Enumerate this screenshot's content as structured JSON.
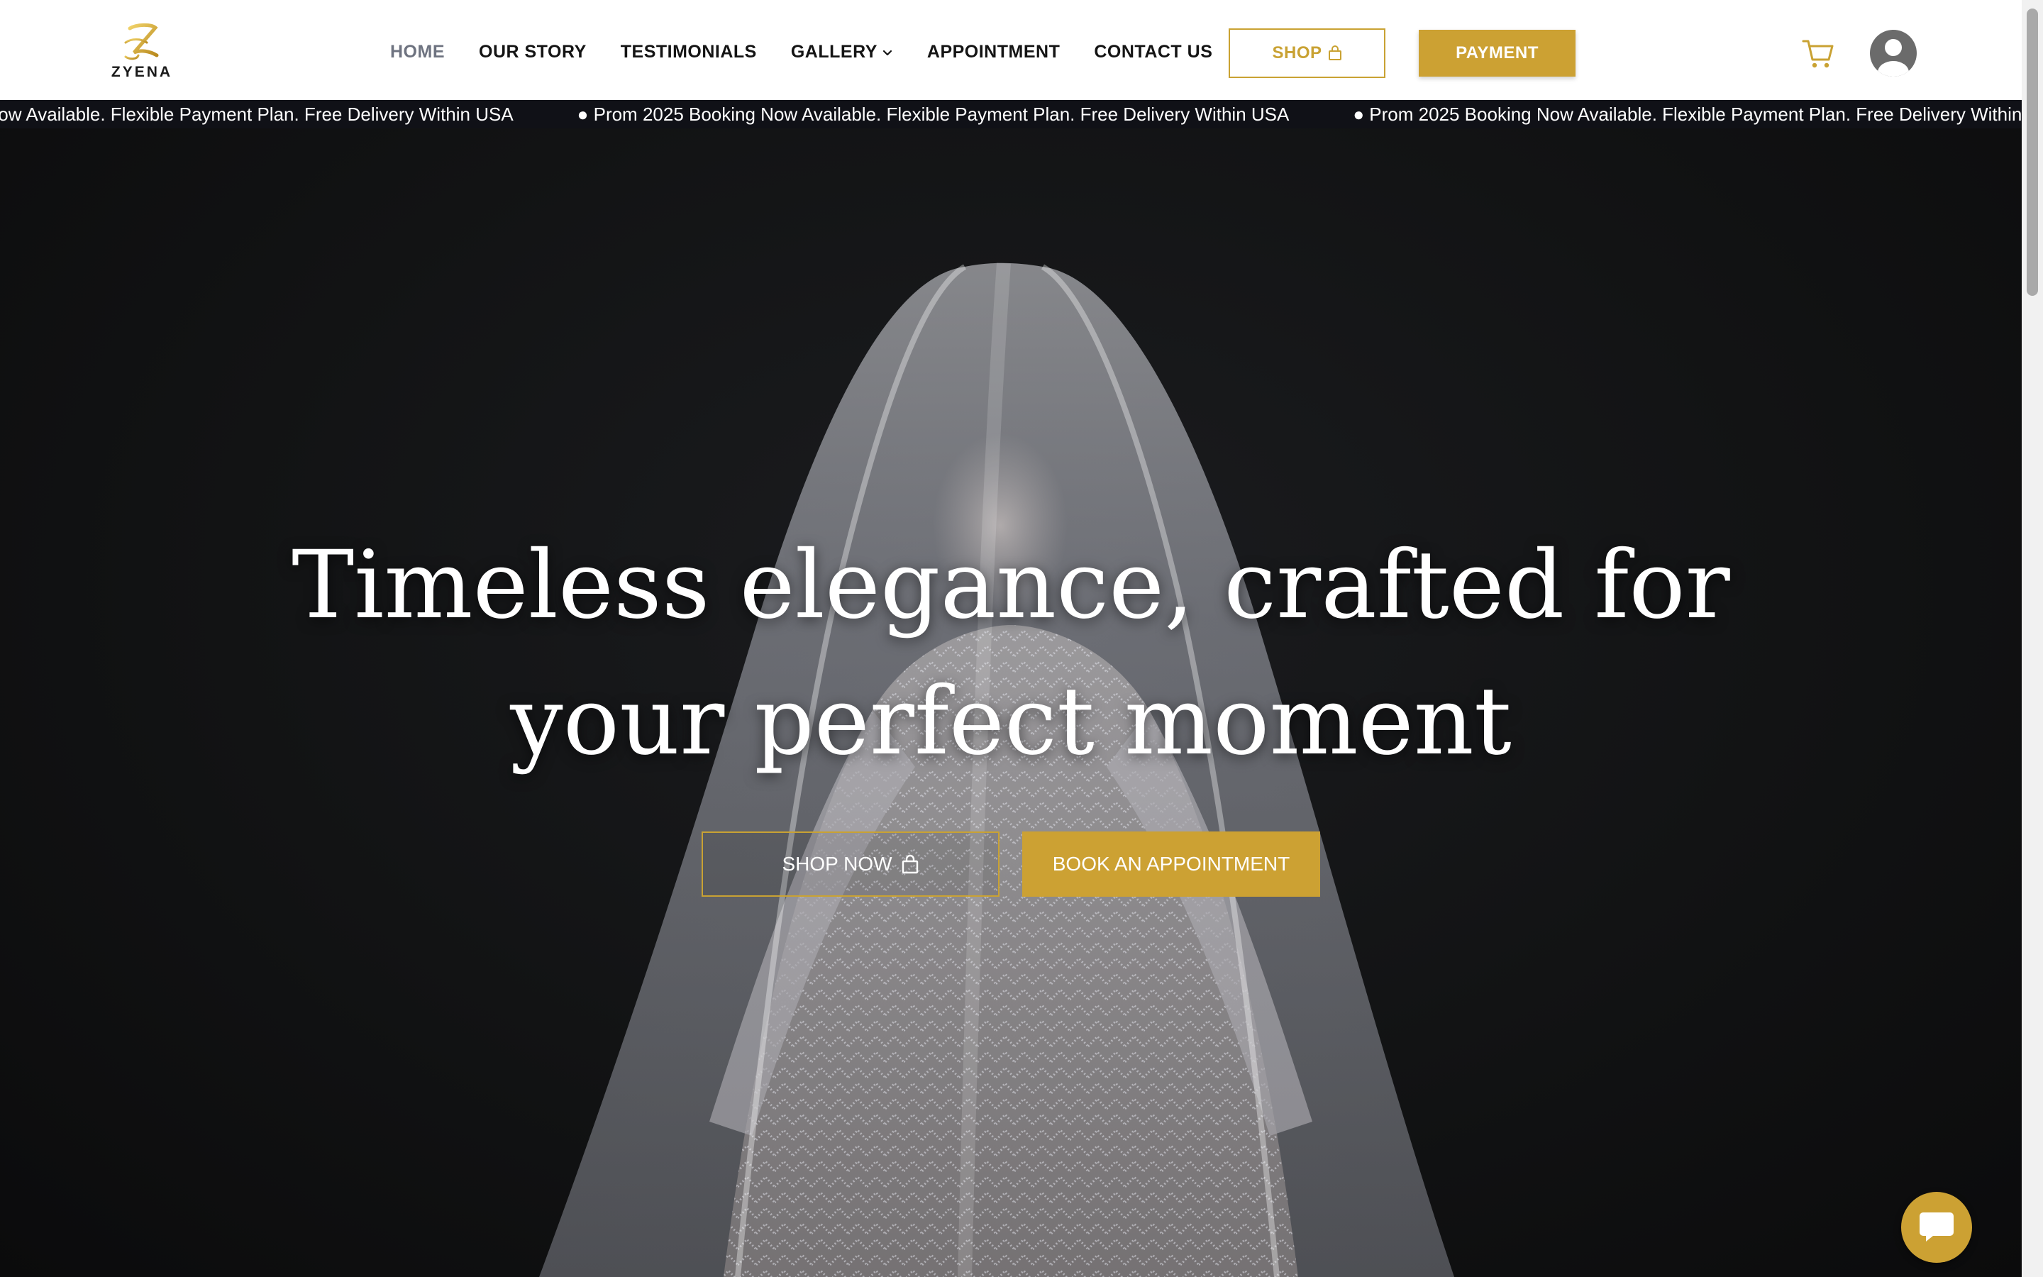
{
  "brand": {
    "name": "ZYENA",
    "accent": "#cca133"
  },
  "nav": {
    "items": [
      {
        "label": "HOME",
        "active": true
      },
      {
        "label": "OUR STORY"
      },
      {
        "label": "TESTIMONIALS"
      },
      {
        "label": "GALLERY",
        "has_dropdown": true
      },
      {
        "label": "APPOINTMENT"
      },
      {
        "label": "CONTACT US"
      }
    ],
    "shop_label": "SHOP",
    "payment_label": "PAYMENT",
    "icons": [
      "cart-icon",
      "user-avatar-icon",
      "chevron-down-icon",
      "shopping-bag-icon"
    ]
  },
  "ticker": {
    "message": "● Prom 2025 Booking Now Available. Flexible Payment Plan. Free Delivery Within USA"
  },
  "hero": {
    "title_line1": "Timeless elegance, crafted for",
    "title_line2": "your perfect moment",
    "shop_now_label": "SHOP NOW",
    "book_label": "BOOK AN APPOINTMENT"
  },
  "chat": {
    "icon": "chat-bubble-icon"
  }
}
